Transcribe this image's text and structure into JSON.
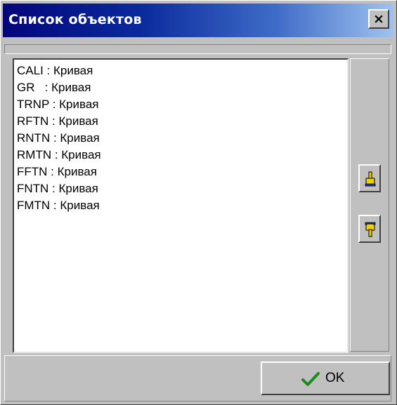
{
  "window": {
    "title": "Список объектов",
    "close_label": "×"
  },
  "list": {
    "items": [
      "CALI : Кривая",
      "GR   : Кривая",
      "TRNP : Кривая",
      "RFTN : Кривая",
      "RNTN : Кривая",
      "RMTN : Кривая",
      "FFTN : Кривая",
      "FNTN : Кривая",
      "FMTN : Кривая"
    ]
  },
  "side_buttons": {
    "up_icon": "hand-pointing-up-icon",
    "down_icon": "hand-pointing-down-icon"
  },
  "footer": {
    "ok_label": "OK",
    "ok_icon": "checkmark-icon"
  },
  "colors": {
    "title_gradient_start": "#04067a",
    "title_gradient_end": "#9fc3ee",
    "face": "#c0c0c0",
    "check_green": "#1e8a1e",
    "hand_yellow": "#f0d000"
  }
}
